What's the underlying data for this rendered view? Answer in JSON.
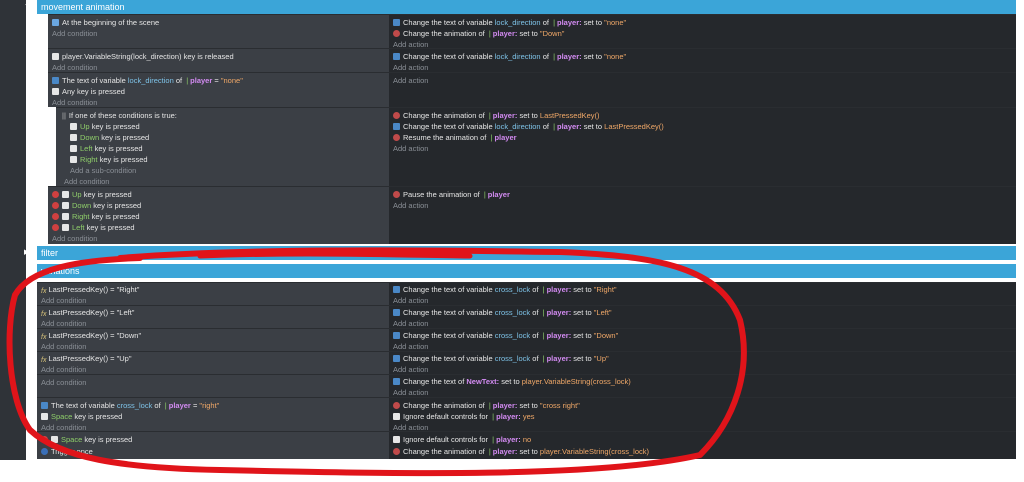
{
  "groups": {
    "movement": "movement animation",
    "filter": "filter",
    "variations": "variations"
  },
  "events": {
    "e1_cond": "At the beginning of the scene",
    "e1_a1_pre": "Change the text of variable",
    "e1_a1_var": "lock_direction",
    "e1_a1_of": "of",
    "e1_a1_obj": "player:",
    "e1_a1_set": "set to",
    "e1_a1_val": "\"none\"",
    "e1_a2_pre": "Change the animation of",
    "e1_a2_obj": "player:",
    "e1_a2_set": "set to",
    "e1_a2_val": "\"Down\"",
    "e2_cond": "player.VariableString(lock_direction) key is released",
    "e2_a1_pre": "Change the text of variable",
    "e2_a1_var": "lock_direction",
    "e2_a1_of": "of",
    "e2_a1_obj": "player:",
    "e2_a1_set": "set to",
    "e2_a1_val": "\"none\"",
    "e3_c1_pre": "The text of variable",
    "e3_c1_var": "lock_direction",
    "e3_c1_of": "of",
    "e3_c1_obj": "player",
    "e3_c1_eq": "=",
    "e3_c1_val": "\"none\"",
    "e3_c2": "Any key is pressed",
    "or_title": "If one of these conditions is true:",
    "or_up": "Up",
    "or_down": "Down",
    "or_left": "Left",
    "or_right": "Right",
    "key_pressed": "key is pressed",
    "add_sub": "Add a sub-condition",
    "e4_a1_pre": "Change the animation of",
    "e4_a1_obj": "player:",
    "e4_a1_set": "set to",
    "e4_a1_val": "LastPressedKey()",
    "e4_a2_pre": "Change the text of variable",
    "e4_a2_var": "lock_direction",
    "e4_a2_of": "of",
    "e4_a2_obj": "player:",
    "e4_a2_set": "set to",
    "e4_a2_val": "LastPressedKey()",
    "e4_a3_pre": "Resume the animation of",
    "e4_a3_obj": "player",
    "e5_a1_pre": "Pause the animation of",
    "e5_a1_obj": "player",
    "v1_cond": "LastPressedKey() = \"Right\"",
    "v2_cond": "LastPressedKey() = \"Left\"",
    "v3_cond": "LastPressedKey() = \"Down\"",
    "v4_cond": "LastPressedKey() = \"Up\"",
    "cross_pre": "Change the text of variable",
    "cross_var": "cross_lock",
    "cross_of": "of",
    "cross_obj": "player:",
    "cross_set": "set to",
    "v1_val": "\"Right\"",
    "v2_val": "\"Left\"",
    "v3_val": "\"Down\"",
    "v4_val": "\"Up\"",
    "v5_pre": "Change the text of",
    "v5_obj": "NewText:",
    "v5_set": "set to",
    "v5_val": "player.VariableString(cross_lock)",
    "v6_c1_pre": "The text of variable",
    "v6_c1_var": "cross_lock",
    "v6_c1_of": "of",
    "v6_c1_obj": "player",
    "v6_c1_eq": "=",
    "v6_c1_val": "\"right\"",
    "space": "Space",
    "v6_a1_pre": "Change the animation of",
    "v6_a1_obj": "player:",
    "v6_a1_set": "set to",
    "v6_a1_val": "\"cross right\"",
    "v6_a2_pre": "Ignore default controls for",
    "v6_a2_obj": "player:",
    "v6_a2_val": "yes",
    "v7_c2": "Trigger once",
    "v7_a1_pre": "Ignore default controls for",
    "v7_a1_obj": "player:",
    "v7_a1_val": "no",
    "v7_a2_pre": "Change the animation of",
    "v7_a2_obj": "player:",
    "v7_a2_set": "set to",
    "v7_a2_val": "player.VariableString(cross_lock)"
  },
  "ui": {
    "add_condition": "Add condition",
    "add_action": "Add action"
  },
  "colors": {
    "group_bar": "#3ba5d8",
    "condition_bg": "#3b3f45",
    "action_bg": "#25282c",
    "annotation": "#e0141a"
  }
}
